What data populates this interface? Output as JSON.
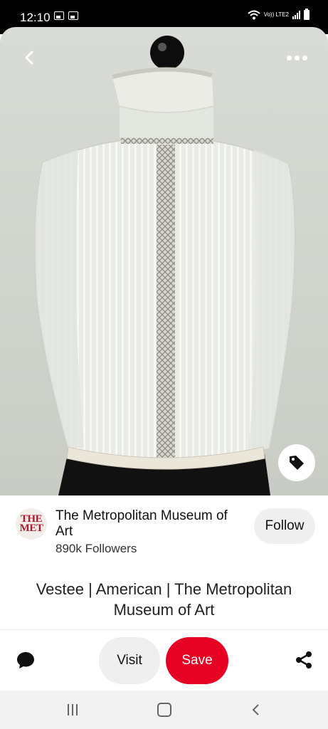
{
  "status": {
    "time": "12:10",
    "network": "Vo)) LTE2"
  },
  "pin": {
    "image_subject": "white lace vestee on mannequin",
    "title": "Vestee | American | The Metropolitan Museum of Art"
  },
  "profile": {
    "avatar_text_line1": "THE",
    "avatar_text_line2": "MET",
    "name": "The Metropolitan Museum of Art",
    "followers": "890k Followers",
    "follow_label": "Follow"
  },
  "actions": {
    "visit_label": "Visit",
    "save_label": "Save"
  },
  "icons": {
    "back": "chevron-left-icon",
    "more": "more-horizontal-icon",
    "tag": "tag-icon",
    "comment": "comment-icon",
    "share": "share-icon"
  },
  "colors": {
    "save": "#e60023",
    "met_red": "#b0172e"
  }
}
